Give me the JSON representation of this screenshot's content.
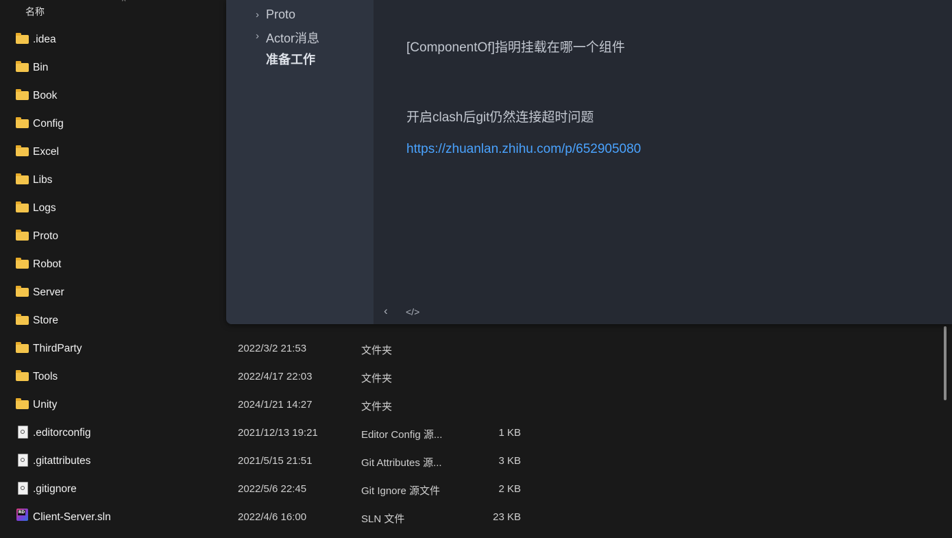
{
  "explorer": {
    "column_header": {
      "name": "名称"
    },
    "rows": [
      {
        "name": ".idea",
        "date": "",
        "type": "",
        "size": "",
        "icon": "folder-icon"
      },
      {
        "name": "Bin",
        "date": "",
        "type": "",
        "size": "",
        "icon": "folder-icon"
      },
      {
        "name": "Book",
        "date": "",
        "type": "",
        "size": "",
        "icon": "folder-icon"
      },
      {
        "name": "Config",
        "date": "",
        "type": "",
        "size": "",
        "icon": "folder-icon"
      },
      {
        "name": "Excel",
        "date": "",
        "type": "",
        "size": "",
        "icon": "folder-icon"
      },
      {
        "name": "Libs",
        "date": "",
        "type": "",
        "size": "",
        "icon": "folder-icon"
      },
      {
        "name": "Logs",
        "date": "",
        "type": "",
        "size": "",
        "icon": "folder-icon"
      },
      {
        "name": "Proto",
        "date": "",
        "type": "",
        "size": "",
        "icon": "folder-icon"
      },
      {
        "name": "Robot",
        "date": "",
        "type": "",
        "size": "",
        "icon": "folder-icon"
      },
      {
        "name": "Server",
        "date": "",
        "type": "",
        "size": "",
        "icon": "folder-icon"
      },
      {
        "name": "Store",
        "date": "",
        "type": "",
        "size": "",
        "icon": "folder-icon"
      },
      {
        "name": "ThirdParty",
        "date": "2022/3/2 21:53",
        "type": "文件夹",
        "size": "",
        "icon": "folder-icon"
      },
      {
        "name": "Tools",
        "date": "2022/4/17 22:03",
        "type": "文件夹",
        "size": "",
        "icon": "folder-icon"
      },
      {
        "name": "Unity",
        "date": "2024/1/21 14:27",
        "type": "文件夹",
        "size": "",
        "icon": "folder-icon"
      },
      {
        "name": ".editorconfig",
        "date": "2021/12/13 19:21",
        "type": "Editor Config 源...",
        "size": "1 KB",
        "icon": "config-file-icon"
      },
      {
        "name": ".gitattributes",
        "date": "2021/5/15 21:51",
        "type": "Git Attributes 源...",
        "size": "3 KB",
        "icon": "config-file-icon"
      },
      {
        "name": ".gitignore",
        "date": "2022/5/6 22:45",
        "type": "Git Ignore 源文件",
        "size": "2 KB",
        "icon": "config-file-icon"
      },
      {
        "name": "Client-Server.sln",
        "date": "2022/4/6 16:00",
        "type": "SLN 文件",
        "size": "23 KB",
        "icon": "rider-sln-icon"
      }
    ]
  },
  "editor": {
    "outline": [
      {
        "label": "Proto",
        "collapsible": true
      },
      {
        "label": "Actor消息",
        "collapsible": true
      },
      {
        "label": "准备工作",
        "collapsible": false,
        "active": true
      }
    ],
    "content": {
      "para1": "[ComponentOf]指明挂载在哪一个组件",
      "para2": "开启clash后git仍然连接超时问题",
      "link": "https://zhuanlan.zhihu.com/p/652905080"
    },
    "footer": {
      "back_icon": "chevron-left-icon",
      "source_icon": "code-icon",
      "back_glyph": "‹",
      "source_glyph": "</>"
    }
  },
  "colors": {
    "explorer_bg": "#191919",
    "editor_sidebar_bg": "#2e3440",
    "editor_content_bg": "#252932",
    "link": "#4aa3ff",
    "folder": "#f4c44b"
  }
}
